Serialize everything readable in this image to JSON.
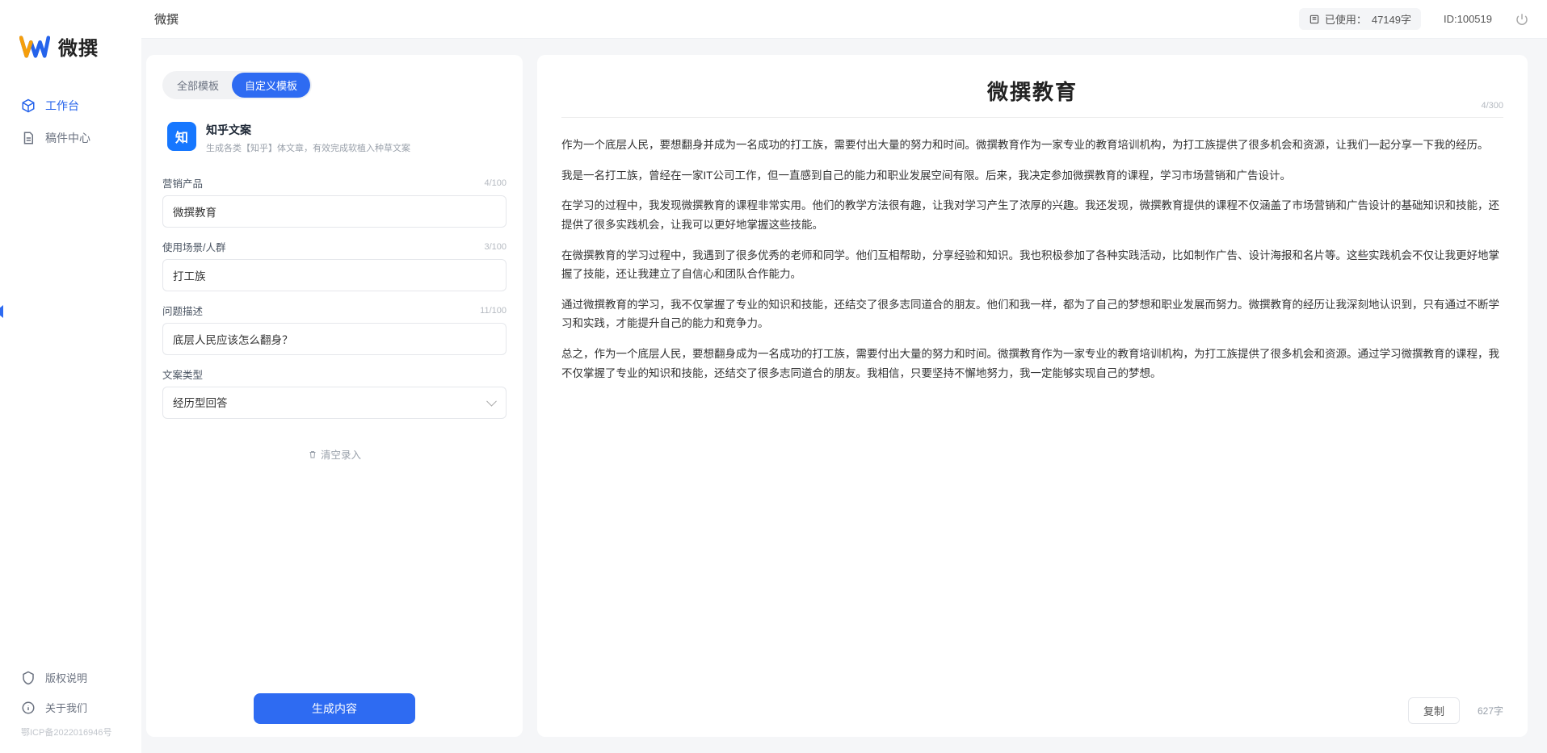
{
  "brand": {
    "name": "微撰"
  },
  "header": {
    "page_title": "微撰",
    "usage_label": "已使用：",
    "usage_value": "47149字",
    "user_id_label": "ID:100519"
  },
  "sidebar": {
    "nav": [
      {
        "label": "工作台",
        "icon": "cube-icon",
        "active": true
      },
      {
        "label": "稿件中心",
        "icon": "doc-icon",
        "active": false
      }
    ],
    "footer": [
      {
        "label": "版权说明",
        "icon": "shield-icon"
      },
      {
        "label": "关于我们",
        "icon": "info-icon"
      }
    ],
    "icp": "鄂ICP备2022016946号"
  },
  "left_panel": {
    "tabs": [
      {
        "label": "全部模板",
        "active": false
      },
      {
        "label": "自定义模板",
        "active": true
      }
    ],
    "template": {
      "badge_text": "知",
      "title": "知乎文案",
      "desc": "生成各类【知乎】体文章，有效完成软植入种草文案"
    },
    "fields": [
      {
        "key": "product",
        "label": "营销产品",
        "value": "微撰教育",
        "count": "4/100",
        "type": "text"
      },
      {
        "key": "scene",
        "label": "使用场景/人群",
        "value": "打工族",
        "count": "3/100",
        "type": "text"
      },
      {
        "key": "problem",
        "label": "问题描述",
        "value": "底层人民应该怎么翻身？",
        "count": "11/100",
        "type": "text"
      },
      {
        "key": "style",
        "label": "文案类型",
        "value": "经历型回答",
        "count": "",
        "type": "select"
      }
    ],
    "clear_label": "清空录入",
    "generate_label": "生成内容"
  },
  "right_panel": {
    "title": "微撰教育",
    "title_count": "4/300",
    "paragraphs": [
      "作为一个底层人民，要想翻身并成为一名成功的打工族，需要付出大量的努力和时间。微撰教育作为一家专业的教育培训机构，为打工族提供了很多机会和资源，让我们一起分享一下我的经历。",
      "我是一名打工族，曾经在一家IT公司工作，但一直感到自己的能力和职业发展空间有限。后来，我决定参加微撰教育的课程，学习市场营销和广告设计。",
      "在学习的过程中，我发现微撰教育的课程非常实用。他们的教学方法很有趣，让我对学习产生了浓厚的兴趣。我还发现，微撰教育提供的课程不仅涵盖了市场营销和广告设计的基础知识和技能，还提供了很多实践机会，让我可以更好地掌握这些技能。",
      "在微撰教育的学习过程中，我遇到了很多优秀的老师和同学。他们互相帮助，分享经验和知识。我也积极参加了各种实践活动，比如制作广告、设计海报和名片等。这些实践机会不仅让我更好地掌握了技能，还让我建立了自信心和团队合作能力。",
      "通过微撰教育的学习，我不仅掌握了专业的知识和技能，还结交了很多志同道合的朋友。他们和我一样，都为了自己的梦想和职业发展而努力。微撰教育的经历让我深刻地认识到，只有通过不断学习和实践，才能提升自己的能力和竞争力。",
      "总之，作为一个底层人民，要想翻身成为一名成功的打工族，需要付出大量的努力和时间。微撰教育作为一家专业的教育培训机构，为打工族提供了很多机会和资源。通过学习微撰教育的课程，我不仅掌握了专业的知识和技能，还结交了很多志同道合的朋友。我相信，只要坚持不懈地努力，我一定能够实现自己的梦想。"
    ],
    "copy_label": "复制",
    "char_count": "627字"
  }
}
